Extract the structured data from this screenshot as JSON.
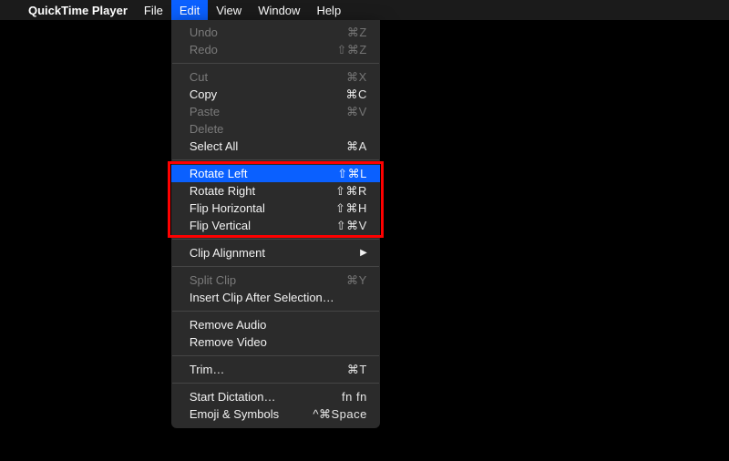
{
  "menubar": {
    "app_name": "QuickTime Player",
    "items": [
      "File",
      "Edit",
      "View",
      "Window",
      "Help"
    ],
    "open_index": 1
  },
  "edit_menu": {
    "groups": [
      [
        {
          "label": "Undo",
          "shortcut": "⌘Z",
          "enabled": false
        },
        {
          "label": "Redo",
          "shortcut": "⇧⌘Z",
          "enabled": false
        }
      ],
      [
        {
          "label": "Cut",
          "shortcut": "⌘X",
          "enabled": false
        },
        {
          "label": "Copy",
          "shortcut": "⌘C",
          "enabled": true
        },
        {
          "label": "Paste",
          "shortcut": "⌘V",
          "enabled": false
        },
        {
          "label": "Delete",
          "shortcut": "",
          "enabled": false
        },
        {
          "label": "Select All",
          "shortcut": "⌘A",
          "enabled": true
        }
      ],
      [
        {
          "label": "Rotate Left",
          "shortcut": "⇧⌘L",
          "enabled": true,
          "highlight": true
        },
        {
          "label": "Rotate Right",
          "shortcut": "⇧⌘R",
          "enabled": true
        },
        {
          "label": "Flip Horizontal",
          "shortcut": "⇧⌘H",
          "enabled": true
        },
        {
          "label": "Flip Vertical",
          "shortcut": "⇧⌘V",
          "enabled": true
        }
      ],
      [
        {
          "label": "Clip Alignment",
          "submenu": true,
          "enabled": true
        }
      ],
      [
        {
          "label": "Split Clip",
          "shortcut": "⌘Y",
          "enabled": false
        },
        {
          "label": "Insert Clip After Selection…",
          "shortcut": "",
          "enabled": true
        }
      ],
      [
        {
          "label": "Remove Audio",
          "shortcut": "",
          "enabled": true
        },
        {
          "label": "Remove Video",
          "shortcut": "",
          "enabled": true
        }
      ],
      [
        {
          "label": "Trim…",
          "shortcut": "⌘T",
          "enabled": true
        }
      ],
      [
        {
          "label": "Start Dictation…",
          "shortcut": "fn fn",
          "enabled": true
        },
        {
          "label": "Emoji & Symbols",
          "shortcut": "^⌘Space",
          "enabled": true
        }
      ]
    ]
  },
  "annotation": {
    "highlight_group_index": 2
  }
}
